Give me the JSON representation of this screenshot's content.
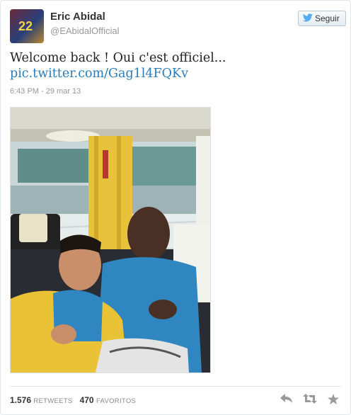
{
  "tweet": {
    "author_name": "Eric Abidal",
    "handle": "@EAbidalOfficial",
    "follow_label": "Seguir",
    "text": "Welcome back ! Oui c'est officiel...",
    "link": "pic.twitter.com/Gag1l4FQKv",
    "timestamp": "6:43 PM - 29 mar 13",
    "avatar_number": "22"
  },
  "stats": {
    "retweets_count": "1.576",
    "retweets_label": "RETWEETS",
    "favorites_count": "470",
    "favorites_label": "FAVORITOS"
  },
  "icons": {
    "follow": "bird-icon",
    "reply": "reply-icon",
    "retweet": "retweet-icon",
    "favorite": "star-icon"
  },
  "colors": {
    "link": "#2b7bb9",
    "muted": "#999999",
    "text": "#222222"
  }
}
